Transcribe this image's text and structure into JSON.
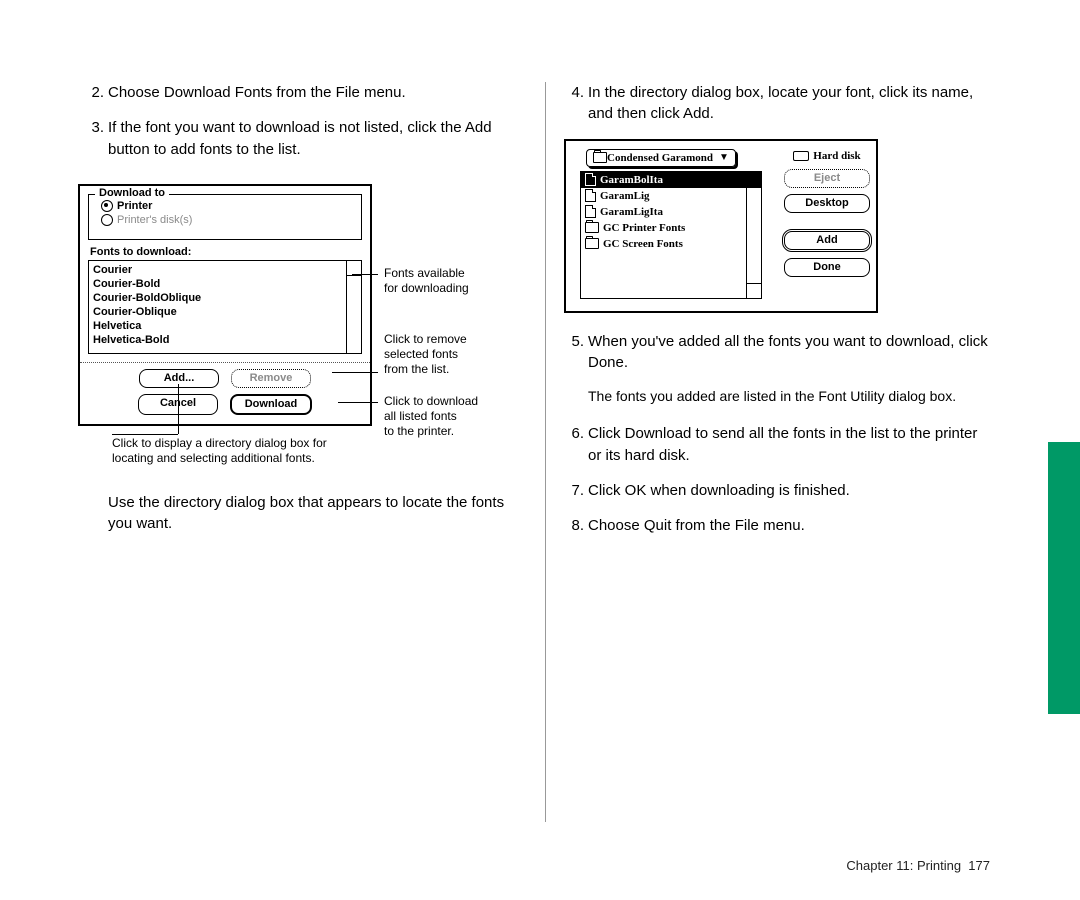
{
  "left": {
    "step2": "Choose Download Fonts from the File menu.",
    "step3": "If the font you want to download is not listed, click the Add button to add fonts to the list.",
    "afterFig": "Use the directory dialog box that appears to locate the fonts you want."
  },
  "fig1": {
    "grp_title": "Download to",
    "radio_printer": "Printer",
    "radio_disks": "Printer's disk(s)",
    "fonts_hdr": "Fonts to download:",
    "fonts": [
      "Courier",
      "Courier-Bold",
      "Courier-BoldOblique",
      "Courier-Oblique",
      "Helvetica",
      "Helvetica-Bold"
    ],
    "btn_add": "Add...",
    "btn_remove": "Remove",
    "btn_cancel": "Cancel",
    "btn_download": "Download",
    "anno_upper_l1": "Fonts available",
    "anno_upper_l2": "for downloading",
    "anno_mid_l1": "Click to remove",
    "anno_mid_l2": "selected fonts",
    "anno_mid_l3": "from the list.",
    "anno_low_l1": "Click to download",
    "anno_low_l2": "all listed fonts",
    "anno_low_l3": "to the printer.",
    "cap_l1": "Click to display a directory dialog box for",
    "cap_l2": "locating and selecting additional fonts."
  },
  "right": {
    "step4": "In the directory dialog box, locate your font, click its name, and then click Add.",
    "step5": "When you've added all the fonts you want to download, click Done.",
    "step5b": "The fonts you added are listed in the Font Utility dialog box.",
    "step6": "Click Download to send all the fonts in the list to the printer or its hard disk.",
    "step7": "Click OK when downloading is finished.",
    "step8": "Choose Quit from the File menu."
  },
  "fig2": {
    "popup": "Condensed Garamond",
    "items": [
      {
        "icon": "doc",
        "label": "GaramBolIta",
        "sel": true
      },
      {
        "icon": "doc",
        "label": "GaramLig",
        "sel": false
      },
      {
        "icon": "doc",
        "label": "GaramLigIta",
        "sel": false
      },
      {
        "icon": "fld",
        "label": "GC Printer Fonts",
        "sel": false
      },
      {
        "icon": "fld",
        "label": "GC Screen Fonts",
        "sel": false
      }
    ],
    "hd_label": "Hard disk",
    "btn_eject": "Eject",
    "btn_desktop": "Desktop",
    "btn_add": "Add",
    "btn_done": "Done"
  },
  "footer": {
    "chapter": "Chapter 11: Printing",
    "page": "177"
  }
}
